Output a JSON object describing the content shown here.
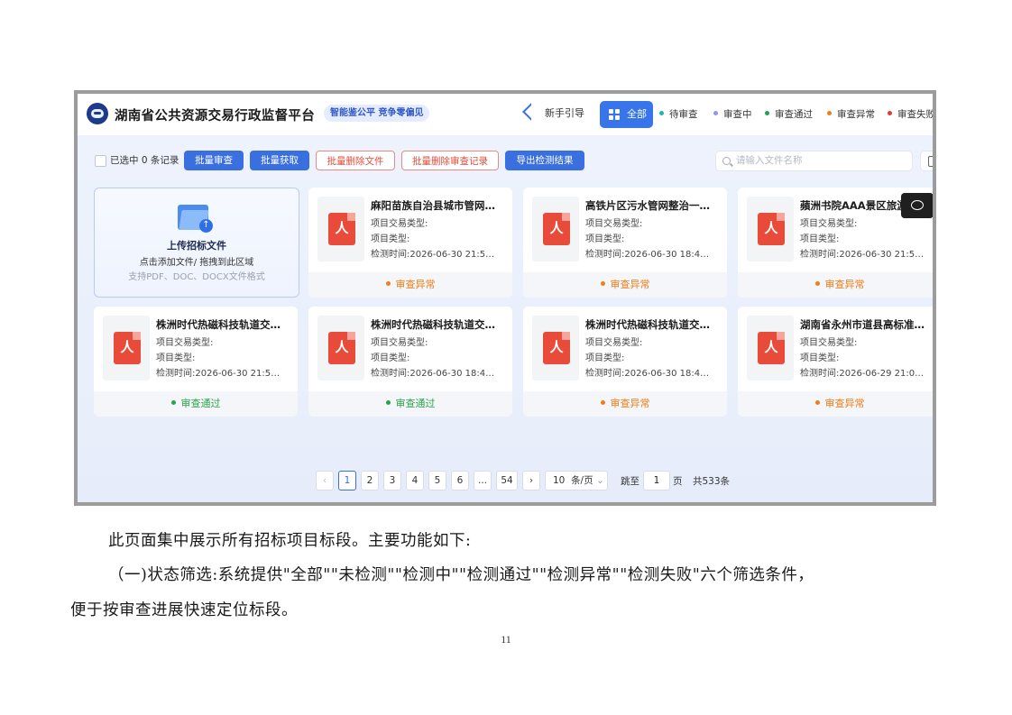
{
  "app": {
    "title": "湖南省公共资源交易行政监督平台",
    "slogan": "智能鉴公平 竞争零偏见",
    "guide_label": "新手引导"
  },
  "status_tabs": [
    {
      "label": "全部",
      "active": true,
      "color": "#3875ea"
    },
    {
      "label": "待审查",
      "color": "#1bb7b7"
    },
    {
      "label": "审查中",
      "color": "#8f97f2"
    },
    {
      "label": "审查通过",
      "color": "#1ba356"
    },
    {
      "label": "审查异常",
      "color": "#ee7e1a"
    },
    {
      "label": "审查失败",
      "color": "#e53935"
    }
  ],
  "toolbar": {
    "selected_text": "已选中 0 条记录",
    "batch_review": "批量审查",
    "batch_fetch": "批量获取",
    "batch_delete_files": "批量删除文件",
    "batch_delete_records": "批量删除审查记录",
    "export_results": "导出检测结果",
    "search_placeholder": "请输入文件名称"
  },
  "upload": {
    "folder_text": "招标文件",
    "title": "上传招标文件",
    "hint": "点击添加文件/ 拖拽到此区域",
    "formats": "支持PDF、DOC、DOCX文件格式"
  },
  "meta_labels": {
    "trade_type": "项目交易类型:",
    "project_type": "项目类型:",
    "check_time": "检测时间:"
  },
  "cards": [
    {
      "title": "麻阳苗族自治县城市管网…",
      "time": "2026-06-30 21:5…",
      "status": "审查异常",
      "status_kind": "abnormal"
    },
    {
      "title": "高铁片区污水管网整治一…",
      "time": "2026-06-30 18:4…",
      "status": "审查异常",
      "status_kind": "abnormal"
    },
    {
      "title": "蘋洲书院AAA景区旅游…",
      "time": "2026-06-30 21:5…",
      "status": "审查异常",
      "status_kind": "abnormal"
    },
    {
      "title": "株洲时代热磁科技轨道交…",
      "time": "2026-06-30 21:5…",
      "status": "审查通过",
      "status_kind": "pass"
    },
    {
      "title": "株洲时代热磁科技轨道交…",
      "time": "2026-06-30 18:4…",
      "status": "审查通过",
      "status_kind": "pass"
    },
    {
      "title": "株洲时代热磁科技轨道交…",
      "time": "2026-06-30 18:4…",
      "status": "审查异常",
      "status_kind": "abnormal"
    },
    {
      "title": "湖南省永州市道县高标准…",
      "time": "2026-06-29 21:0…",
      "status": "审查异常",
      "status_kind": "abnormal"
    }
  ],
  "pagination": {
    "pages": [
      "1",
      "2",
      "3",
      "4",
      "5",
      "6",
      "...",
      "54"
    ],
    "current": "1",
    "prev": "‹",
    "next": "›",
    "page_size": "10",
    "page_size_unit": "条/页",
    "jump_label": "跳至",
    "jump_value": "1",
    "page_unit": "页",
    "total": "共533条"
  },
  "document": {
    "line1": "此页面集中展示所有招标项目标段。主要功能如下:",
    "line2": "（一)状态筛选:系统提供\"全部\"\"未检测\"\"检测中\"\"检测通过\"\"检测异常\"\"检测失败\"六个筛选条件，",
    "line3": "便于按审查进展快速定位标段。",
    "page_number": "11"
  }
}
